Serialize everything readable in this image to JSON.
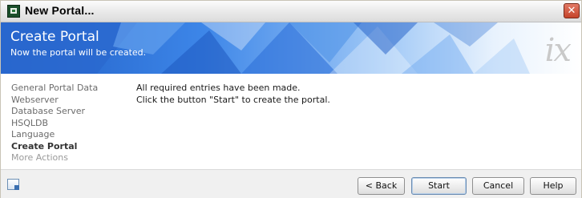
{
  "window": {
    "title": "New Portal...",
    "close_glyph": "✕"
  },
  "banner": {
    "title": "Create Portal",
    "subtitle": "Now the portal will be created.",
    "logo_text": "ix"
  },
  "nav": {
    "items": [
      {
        "label": "General Portal Data",
        "state": "done"
      },
      {
        "label": "Webserver",
        "state": "done"
      },
      {
        "label": "Database Server",
        "state": "done"
      },
      {
        "label": "HSQLDB",
        "state": "done"
      },
      {
        "label": "Language",
        "state": "done"
      },
      {
        "label": "Create Portal",
        "state": "active"
      },
      {
        "label": "More Actions",
        "state": "future"
      }
    ]
  },
  "main": {
    "lines": [
      "All required entries have been made.",
      "Click the button \"Start\" to create the portal."
    ]
  },
  "buttons": {
    "back": "< Back",
    "start": "Start",
    "cancel": "Cancel",
    "help": "Help"
  },
  "icons": {
    "app": "portal-app-icon",
    "help": "context-help-icon",
    "close": "close-icon"
  },
  "colors": {
    "banner_blue": "#2f6fd0",
    "close_red": "#c5432a",
    "logo_gray": "#c9c9c9"
  }
}
